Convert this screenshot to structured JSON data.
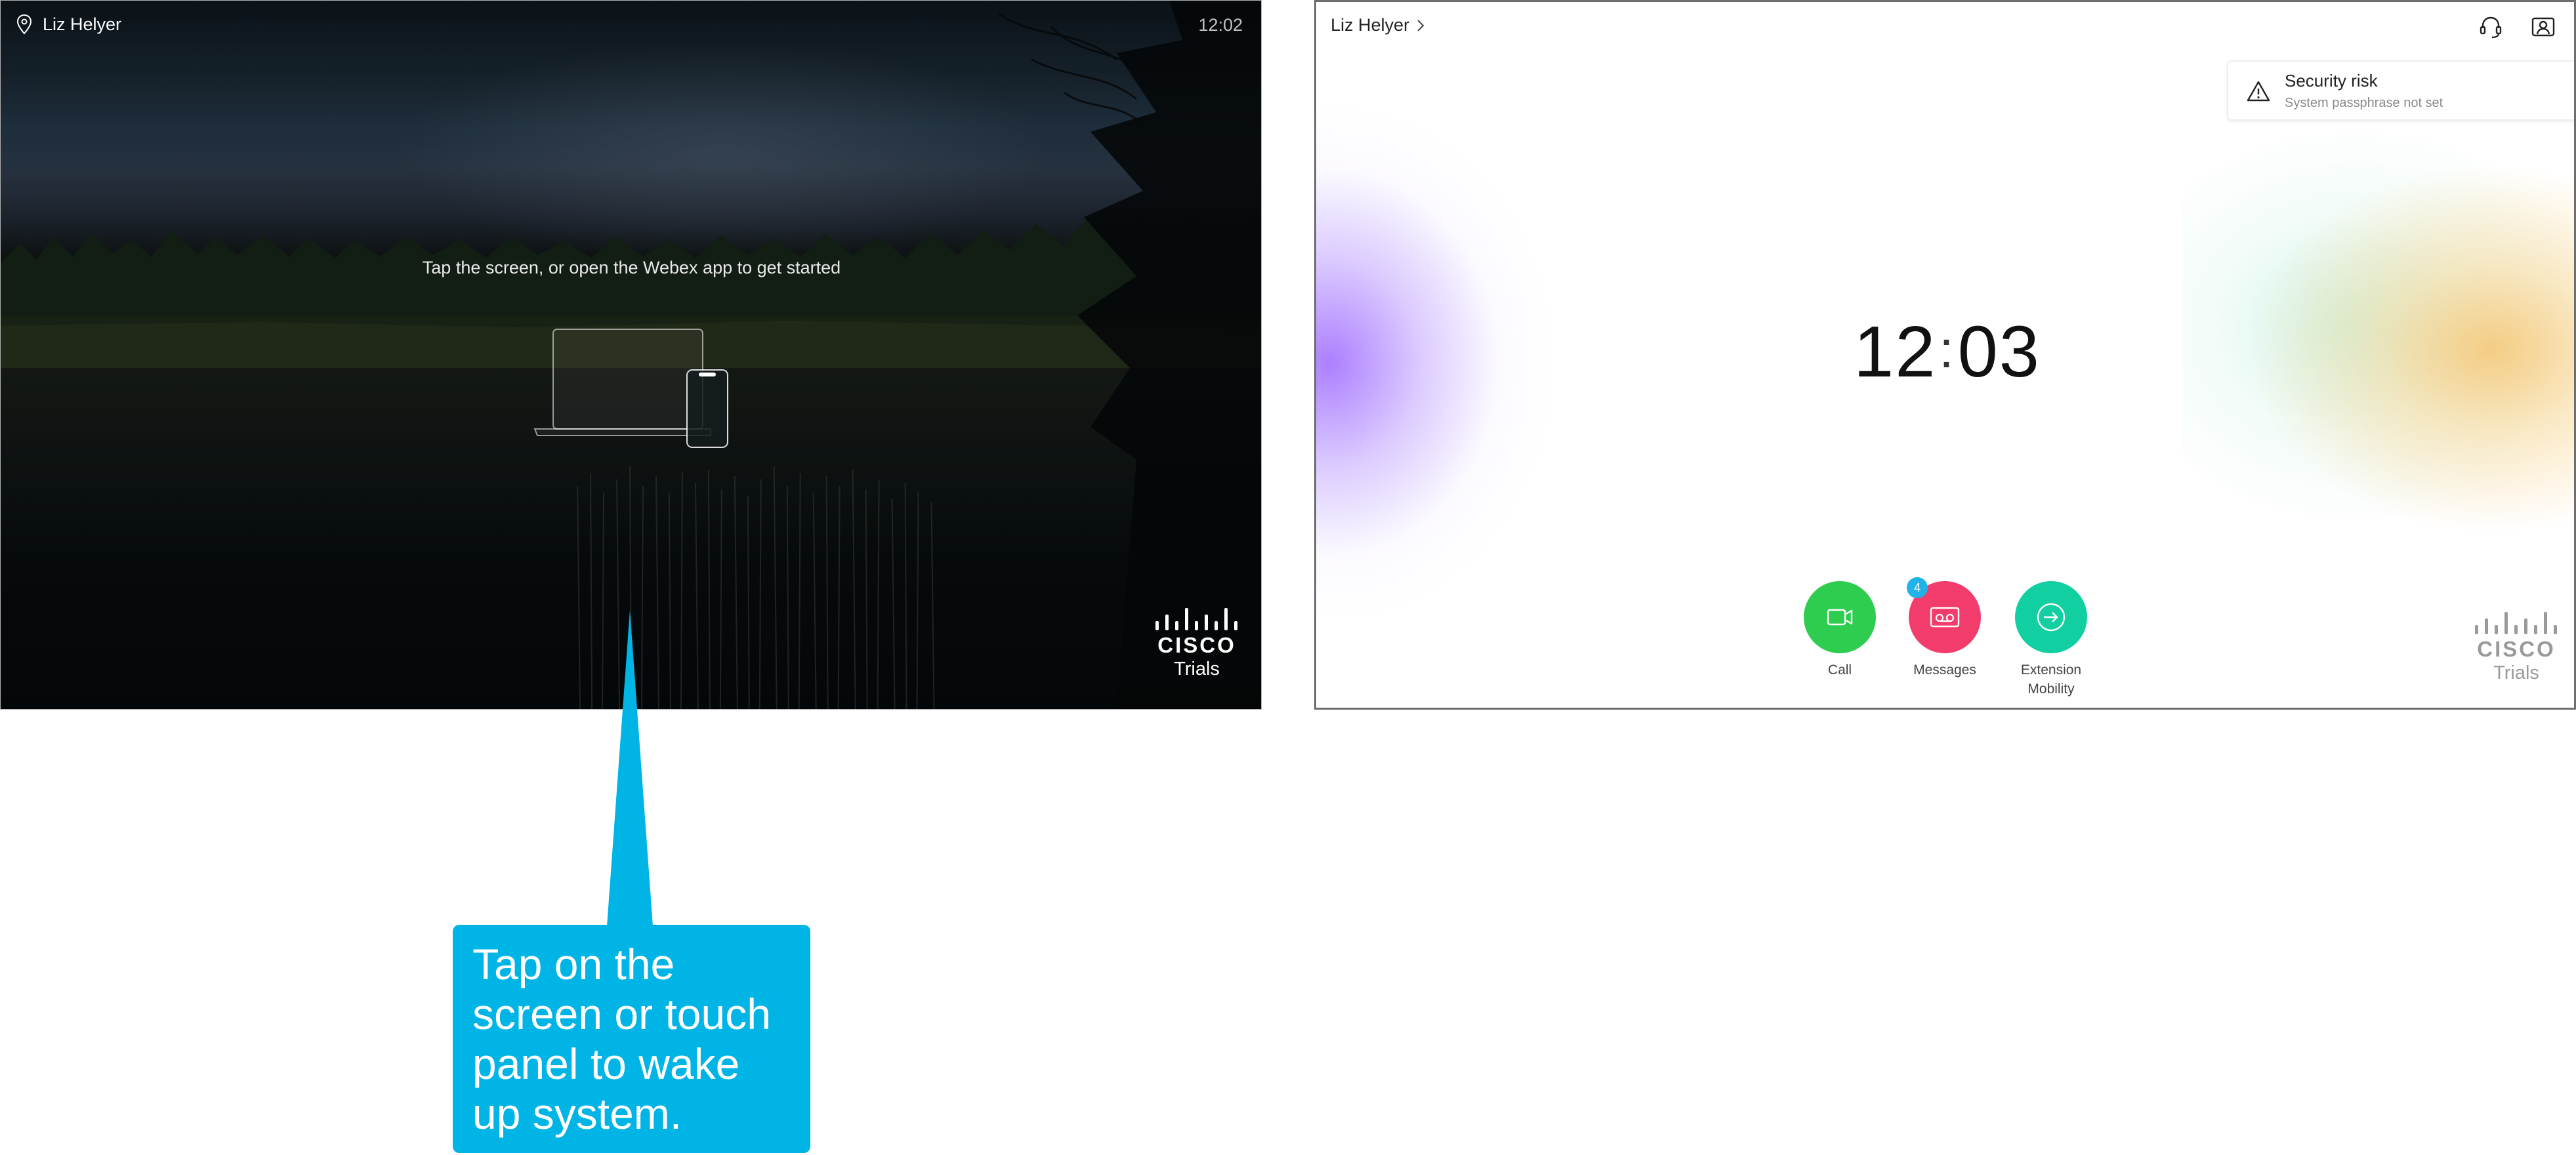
{
  "standby_screen": {
    "user_name": "Liz Helyer",
    "time": "12:02",
    "prompt": "Tap the screen, or open the Webex app to get started",
    "logo_text": "CISCO",
    "logo_subtext": "Trials"
  },
  "callout": {
    "line1": "Tap on the",
    "line2": "screen or touch",
    "line3": "panel to wake",
    "line4": "up system.",
    "color": "#00b4e6"
  },
  "home_screen": {
    "user_name": "Liz Helyer",
    "clock_hours": "12",
    "clock_separator": ":",
    "clock_minutes": "03",
    "alert": {
      "title": "Security risk",
      "subtitle": "System passphrase not set"
    },
    "buttons": [
      {
        "label": "Call",
        "color": "#2ecc4f",
        "icon": "video-camera-icon"
      },
      {
        "label": "Messages",
        "color": "#f23c6b",
        "icon": "voicemail-icon",
        "badge": "4"
      },
      {
        "label": "Extension",
        "label2": "Mobility",
        "color": "#11cfa0",
        "icon": "sign-in-icon"
      }
    ],
    "top_icons": [
      "headset-icon",
      "contact-card-icon"
    ],
    "logo_text": "CISCO",
    "logo_subtext": "Trials"
  }
}
